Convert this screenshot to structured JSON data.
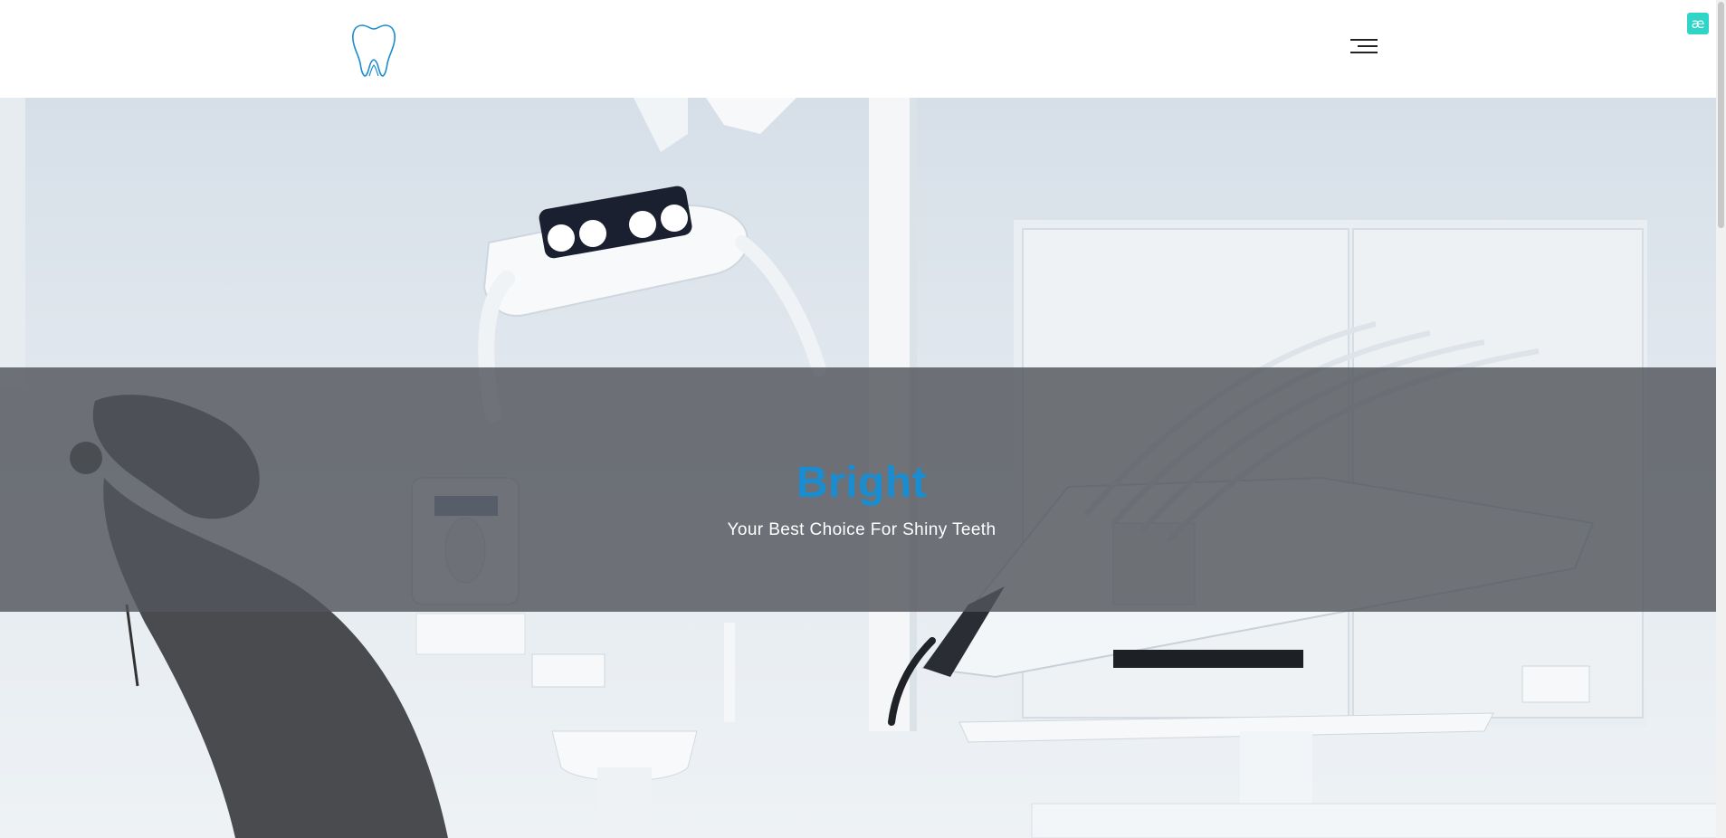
{
  "header": {
    "logo_icon": "tooth-icon",
    "menu_icon": "hamburger-menu-icon",
    "badge_glyph": "æ",
    "brand_color": "#1a8cd0"
  },
  "hero": {
    "title": "Bright",
    "subtitle": "Your Best Choice For Shiny Teeth",
    "background_image": "dental-clinic-chair-photo"
  },
  "colors": {
    "accent": "#1a8cd0",
    "badge": "#2fd5c6",
    "overlay": "#52565c"
  }
}
